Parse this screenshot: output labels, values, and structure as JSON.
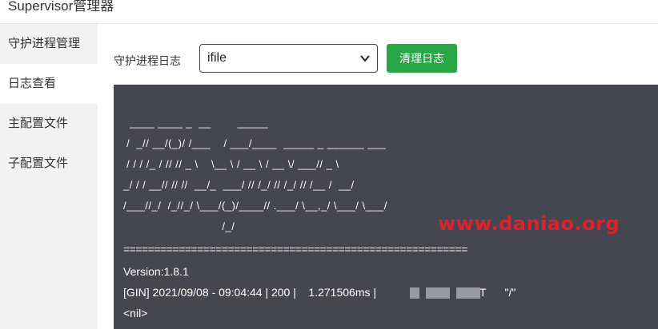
{
  "window": {
    "title": "Supervisor管理器"
  },
  "sidebar": {
    "items": [
      {
        "label": "守护进程管理",
        "active": false
      },
      {
        "label": "日志查看",
        "active": true
      },
      {
        "label": "主配置文件",
        "active": false
      },
      {
        "label": "子配置文件",
        "active": false
      }
    ]
  },
  "toolbar": {
    "label": "守护进程日志",
    "select_value": "ifile",
    "clear_button": "清理日志"
  },
  "console": {
    "lines": [
      "  ____ ____ _  __        _____",
      " /  _// __/(_)/ /___    / ___/____  _____ _ ______ ___",
      " / / / /_ / // // _ \\    \\__ \\ / __ \\ / __ \\/ ___// _ \\",
      "_/ / / __// // //  __/_  ___/ // /_/ // /_/ // /__ /  __/",
      "/___//_/  /_//_/ \\___/(_)/____// .___/ \\__,_/ \\___/ \\___/",
      "                              /_/",
      "========================================================",
      "Version:1.8.1",
      "[GIN] 2021/09/08 - 09:04:44 | 200 |    1.271506ms |                          | GET      \"/\"",
      "<nil>"
    ]
  },
  "watermark": "www.daniao.org",
  "colors": {
    "accent_button": "#28a745",
    "console_bg": "#464650",
    "watermark": "#e0202a"
  }
}
